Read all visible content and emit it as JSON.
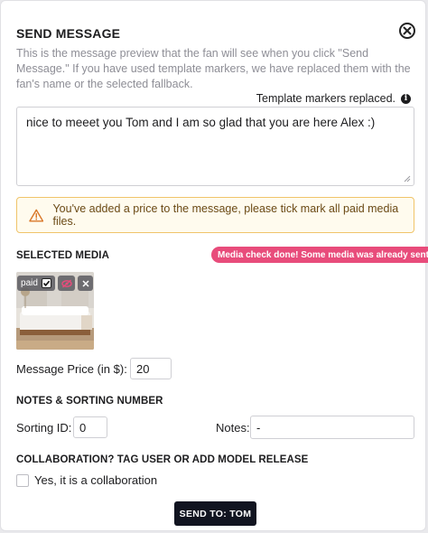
{
  "modal": {
    "title": "SEND MESSAGE",
    "description": "This is the message preview that the fan will see when you click \"Send Message.\" If you have used template markers, we have replaced them with the fan's name or the selected fallback.",
    "markers_note": "Template markers replaced.",
    "message_text": "nice to meeet you Tom and I am so glad that you are here Alex :)",
    "warning": "You've added a price to the message, please tick mark all paid media files.",
    "warning_color": "#f0c46a"
  },
  "media": {
    "heading": "SELECTED MEDIA",
    "badge": "Media check done! Some media was already sent.",
    "badge_color": "#e84c7b",
    "paid_label": "paid",
    "icons": [
      "checkbox-checked-icon",
      "eye-off-icon",
      "close-icon"
    ]
  },
  "price": {
    "label": "Message Price (in $):",
    "value": "20"
  },
  "notes": {
    "heading": "NOTES & SORTING NUMBER",
    "sorting_label": "Sorting ID:",
    "sorting_value": "0",
    "notes_label": "Notes:",
    "notes_value": "-"
  },
  "collaboration": {
    "heading": "COLLABORATION? TAG USER OR ADD MODEL RELEASE",
    "checkbox_label": "Yes, it is a collaboration"
  },
  "send_button": "SEND TO: TOM"
}
